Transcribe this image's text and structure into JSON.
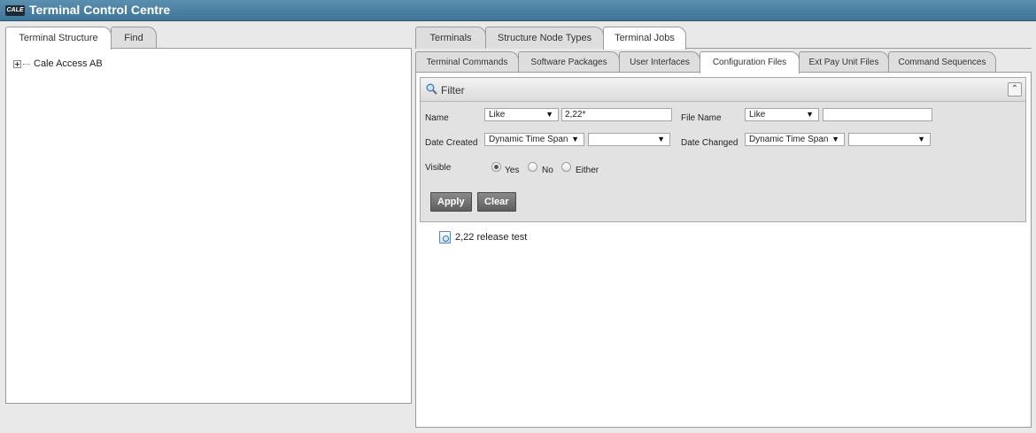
{
  "app": {
    "logo_text": "CALE",
    "title": "Terminal Control Centre"
  },
  "left": {
    "tabs": [
      {
        "label": "Terminal Structure"
      },
      {
        "label": "Find"
      }
    ],
    "tree": [
      {
        "label": "Cale Access AB"
      }
    ]
  },
  "right": {
    "main_tabs": [
      {
        "label": "Terminals"
      },
      {
        "label": "Structure Node Types"
      },
      {
        "label": "Terminal Jobs"
      }
    ],
    "sub_tabs": [
      {
        "label": "Terminal Commands"
      },
      {
        "label": "Software Packages"
      },
      {
        "label": "User Interfaces"
      },
      {
        "label": "Configuration Files"
      },
      {
        "label": "Ext Pay Unit Files"
      },
      {
        "label": "Command Sequences"
      }
    ],
    "filter": {
      "title": "Filter",
      "name_label": "Name",
      "name_op": "Like",
      "name_value": "2,22*",
      "filename_label": "File Name",
      "filename_op": "Like",
      "filename_value": "",
      "date_created_label": "Date Created",
      "date_created_op": "Dynamic Time Span",
      "date_created_value": "",
      "date_changed_label": "Date Changed",
      "date_changed_op": "Dynamic Time Span",
      "date_changed_value": "",
      "visible_label": "Visible",
      "visible_options": [
        {
          "label": "Yes"
        },
        {
          "label": "No"
        },
        {
          "label": "Either"
        }
      ],
      "visible_selected": "Yes",
      "apply_label": "Apply",
      "clear_label": "Clear"
    },
    "results": [
      {
        "label": "2,22 release test"
      }
    ]
  },
  "colors": {
    "titlebar": "#3f7597",
    "button": "#6e6e6e"
  }
}
